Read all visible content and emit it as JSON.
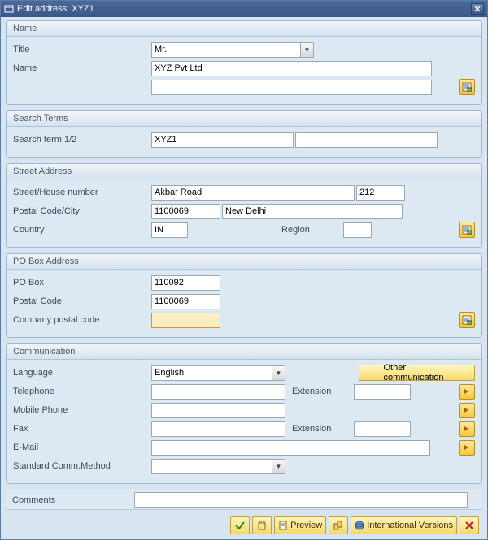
{
  "titlebar": {
    "title": "Edit address:  XYZ1"
  },
  "groups": {
    "name": {
      "header": "Name",
      "title_label": "Title",
      "title_value": "Mr.",
      "name_label": "Name",
      "name_value": "XYZ Pvt Ltd",
      "name2_value": ""
    },
    "search": {
      "header": "Search Terms",
      "term_label": "Search term 1/2",
      "term1_value": "XYZ1",
      "term2_value": ""
    },
    "street": {
      "header": "Street Address",
      "street_label": "Street/House number",
      "street_value": "Akbar Road",
      "house_value": "212",
      "postal_label": "Postal Code/City",
      "postal_value": "1100069",
      "city_value": "New Delhi",
      "country_label": "Country",
      "country_value": "IN",
      "region_label": "Region",
      "region_value": ""
    },
    "pobox": {
      "header": "PO Box Address",
      "pobox_label": "PO Box",
      "pobox_value": "110092",
      "postal_label": "Postal Code",
      "postal_value": "1100069",
      "company_label": "Company postal code",
      "company_value": ""
    },
    "comm": {
      "header": "Communication",
      "language_label": "Language",
      "language_value": "English",
      "other_comm": "Other communication",
      "telephone_label": "Telephone",
      "telephone_value": "",
      "extension_label": "Extension",
      "tel_ext_value": "",
      "mobile_label": "Mobile Phone",
      "mobile_value": "",
      "fax_label": "Fax",
      "fax_value": "",
      "fax_ext_value": "",
      "email_label": "E-Mail",
      "email_value": "",
      "std_label": "Standard Comm.Method",
      "std_value": ""
    }
  },
  "comments": {
    "label": "Comments",
    "value": ""
  },
  "footer": {
    "preview": "Preview",
    "intl": "International Versions"
  }
}
